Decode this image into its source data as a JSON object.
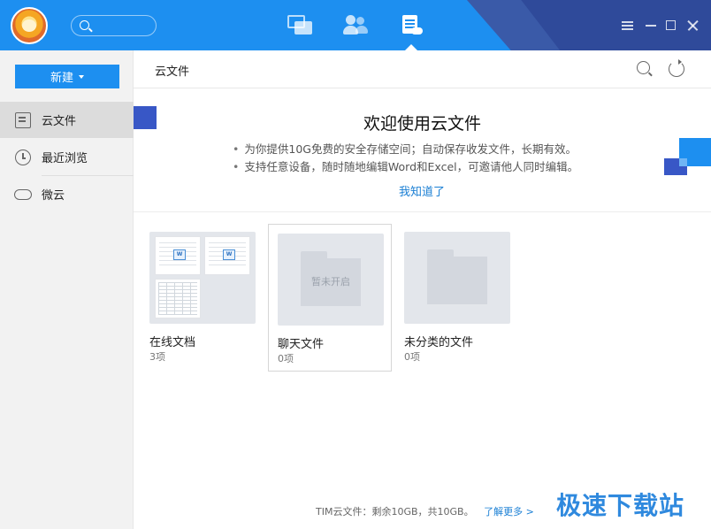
{
  "titlebar": {
    "tabs": [
      {
        "icon": "chat-icon",
        "active": false
      },
      {
        "icon": "contacts-icon",
        "active": false
      },
      {
        "icon": "files-icon",
        "active": true
      }
    ],
    "brand_blue": "#1d8ff0"
  },
  "sidebar": {
    "new_label": "新建",
    "items": [
      {
        "label": "云文件",
        "icon": "cloud-file-icon",
        "active": true
      },
      {
        "label": "最近浏览",
        "icon": "clock-icon",
        "active": false
      },
      {
        "label": "微云",
        "icon": "weiyun-cloud-icon",
        "active": false
      }
    ]
  },
  "main": {
    "breadcrumb": "云文件",
    "welcome": {
      "title": "欢迎使用云文件",
      "bullets": [
        "为你提供10G免费的安全存储空间；自动保存收发文件，长期有效。",
        "支持任意设备，随时随地编辑Word和Excel，可邀请他人同时编辑。"
      ],
      "dismiss_link": "我知道了"
    },
    "folders": [
      {
        "name": "在线文档",
        "count": "3项"
      },
      {
        "name": "聊天文件",
        "count": "0项",
        "overlay": "暂未开启"
      },
      {
        "name": "未分类的文件",
        "count": "0项"
      }
    ],
    "footer": {
      "text": "TIM云文件：剩余10GB，共10GB。",
      "link": "了解更多 >"
    }
  },
  "watermark": "极速下载站",
  "link_color": "#1a7fd4"
}
